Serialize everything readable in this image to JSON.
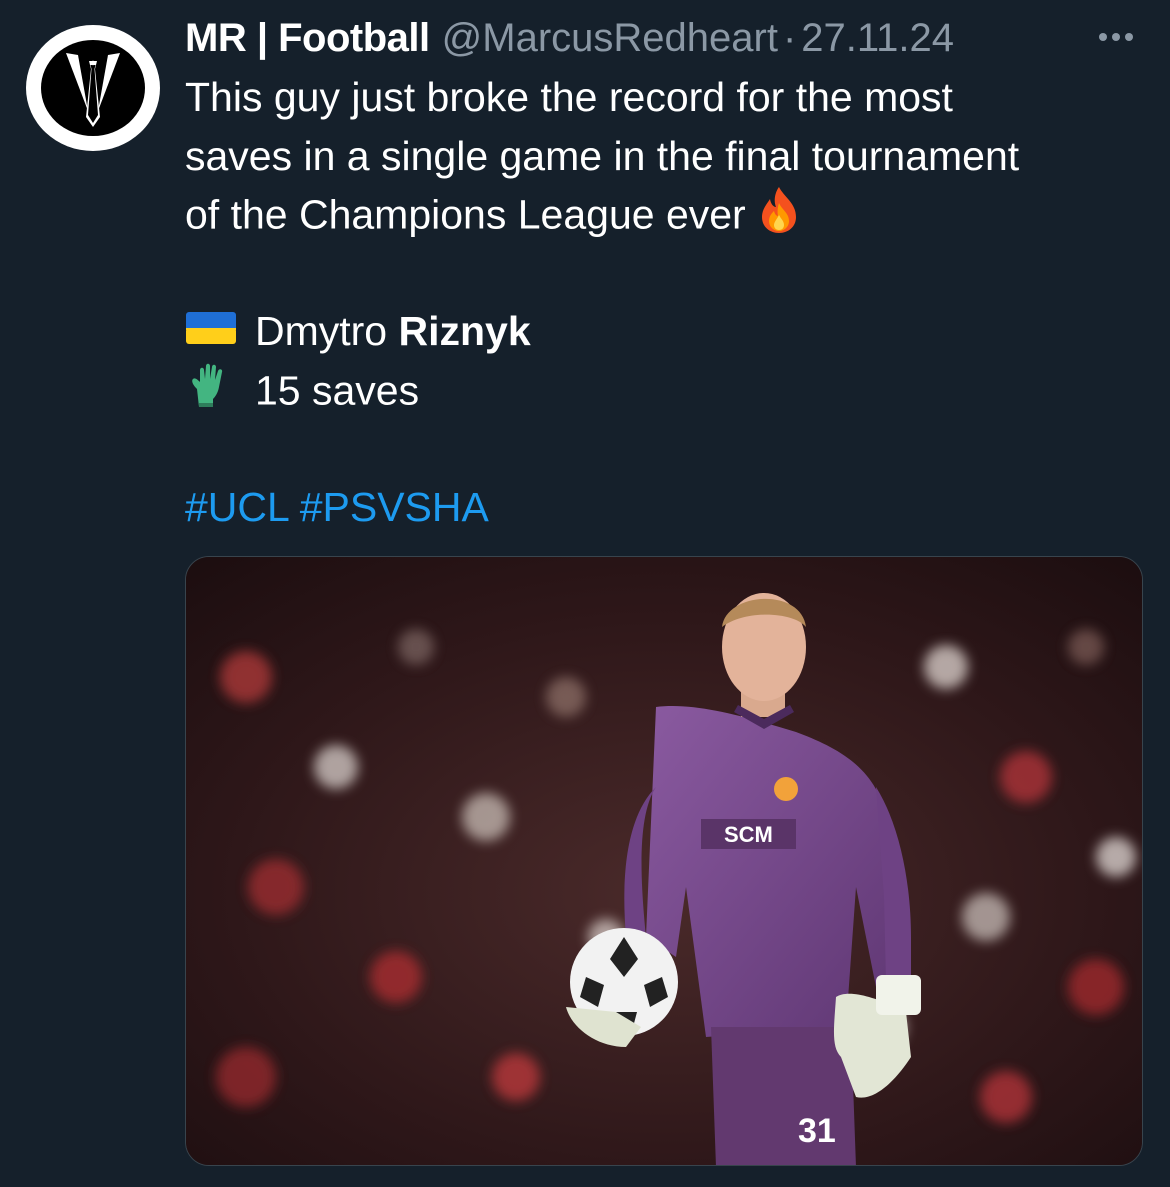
{
  "tweet": {
    "display_name": "MR | Football",
    "handle": "@MarcusRedheart",
    "separator": "·",
    "date": "27.11.24",
    "text_lines": [
      "This guy just broke the record for the most",
      "saves in a single game in the final tournament",
      "of the Champions League ever"
    ],
    "player_first": "Dmytro",
    "player_last": "Riznyk",
    "saves_text": "15 saves",
    "hashtags": [
      "#UCL",
      "#PSVSHA"
    ],
    "media_jersey_text": "SCM",
    "media_number": "31"
  },
  "icons": {
    "avatar": "suit-tie-logo-icon",
    "more": "more-options-icon",
    "fire": "fire-emoji-icon",
    "flag": "ukraine-flag-emoji-icon",
    "glove": "gloves-emoji-icon"
  },
  "colors": {
    "background": "#15202b",
    "text": "#ffffff",
    "secondary": "#8b98a5",
    "link": "#1d9bf0",
    "jersey": "#7d4e92"
  }
}
